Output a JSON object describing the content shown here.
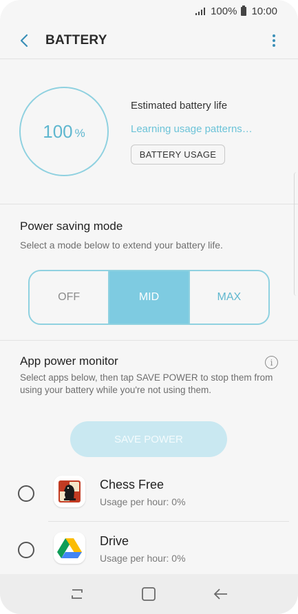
{
  "status_bar": {
    "battery_percent": "100%",
    "time": "10:00"
  },
  "header": {
    "title": "BATTERY"
  },
  "battery": {
    "percent_value": "100",
    "percent_unit": "%",
    "estimated_label": "Estimated battery life",
    "learning_text": "Learning usage patterns…",
    "usage_button": "BATTERY USAGE"
  },
  "power_saving": {
    "title": "Power saving mode",
    "description": "Select a mode below to extend your battery life.",
    "options": [
      "OFF",
      "MID",
      "MAX"
    ],
    "selected": "MID"
  },
  "app_power_monitor": {
    "title": "App power monitor",
    "description": "Select apps below, then tap SAVE POWER to stop them from using your battery while you're not using them.",
    "save_button": "SAVE POWER",
    "apps": [
      {
        "name": "Chess Free",
        "usage": "Usage per hour: 0%",
        "icon": "chess-knight-icon"
      },
      {
        "name": "Drive",
        "usage": "Usage per hour: 0%",
        "icon": "google-drive-icon"
      }
    ]
  },
  "colors": {
    "accent": "#7ecbe1",
    "accent_text": "#5fb7cf",
    "back_arrow": "#3a8fb7"
  }
}
